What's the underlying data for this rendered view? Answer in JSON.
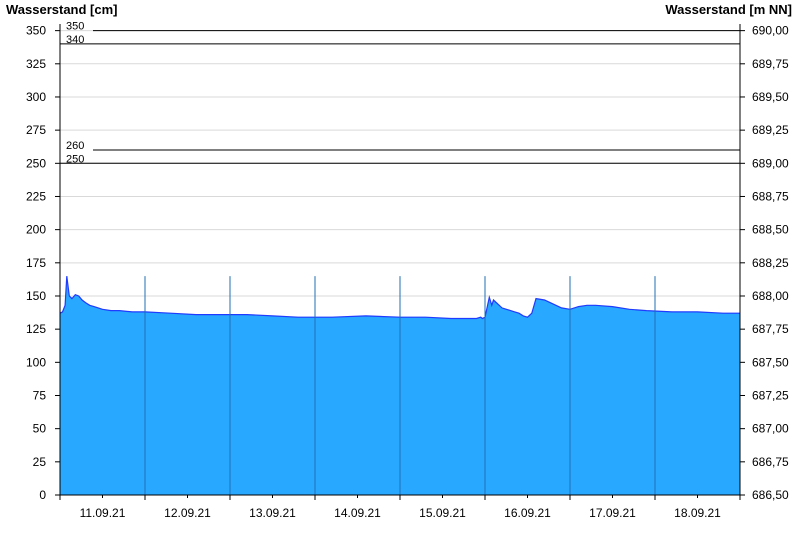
{
  "chart_data": {
    "type": "area",
    "ylabel_left": "Wasserstand [cm]",
    "ylabel_right": "Wasserstand [m NN]",
    "ylim": [
      0,
      355
    ],
    "yticks_left": [
      0,
      25,
      50,
      75,
      100,
      125,
      150,
      175,
      200,
      225,
      250,
      275,
      300,
      325,
      350
    ],
    "yticks_right": [
      "686,50",
      "686,75",
      "687,00",
      "687,25",
      "687,50",
      "687,75",
      "688,00",
      "688,25",
      "688,50",
      "688,75",
      "689,00",
      "689,25",
      "689,50",
      "689,75",
      "690,00"
    ],
    "xlim_days": [
      10.0,
      18.0
    ],
    "x_tick_labels": [
      "11.09.21",
      "12.09.21",
      "13.09.21",
      "14.09.21",
      "15.09.21",
      "16.09.21",
      "17.09.21",
      "18.09.21"
    ],
    "reference_lines": [
      {
        "label": "350",
        "value": 350
      },
      {
        "label": "340",
        "value": 340
      },
      {
        "label": "260",
        "value": 260
      },
      {
        "label": "250",
        "value": 250
      }
    ],
    "series": [
      {
        "x": [
          10.0,
          10.03,
          10.06,
          10.08,
          10.09,
          10.11,
          10.14,
          10.18,
          10.22,
          10.26,
          10.3,
          10.35,
          10.4,
          10.5,
          10.6,
          10.7,
          10.85,
          11.0,
          11.3,
          11.6,
          11.9,
          12.2,
          12.5,
          12.8,
          13.0,
          13.2,
          13.6,
          14.0,
          14.3,
          14.6,
          14.8,
          14.9,
          14.95,
          14.97,
          15.0,
          15.05,
          15.08,
          15.1,
          15.2,
          15.3,
          15.35,
          15.4,
          15.45,
          15.5,
          15.55,
          15.6,
          15.7,
          15.8,
          15.9,
          16.0,
          16.1,
          16.2,
          16.3,
          16.5,
          16.7,
          16.9,
          17.2,
          17.5,
          17.8,
          18.0
        ],
        "y": [
          137,
          138,
          143,
          165,
          160,
          150,
          148,
          151,
          150,
          147,
          145,
          143,
          142,
          140,
          139,
          139,
          138,
          138,
          137,
          136,
          136,
          136,
          135,
          134,
          134,
          134,
          135,
          134,
          134,
          133,
          133,
          133,
          134,
          133,
          134,
          149,
          143,
          147,
          141,
          139,
          138,
          137,
          135,
          134,
          137,
          148,
          147,
          144,
          141,
          140,
          142,
          143,
          143,
          142,
          140,
          139,
          138,
          138,
          137,
          137
        ],
        "fill": "#29a8ff",
        "stroke": "#1f3bff"
      }
    ],
    "colors": {
      "fill": "#29a8ff",
      "edge": "#1f3bff",
      "day_line": "#1e6fb5",
      "grid": "#d9d9d9"
    }
  }
}
